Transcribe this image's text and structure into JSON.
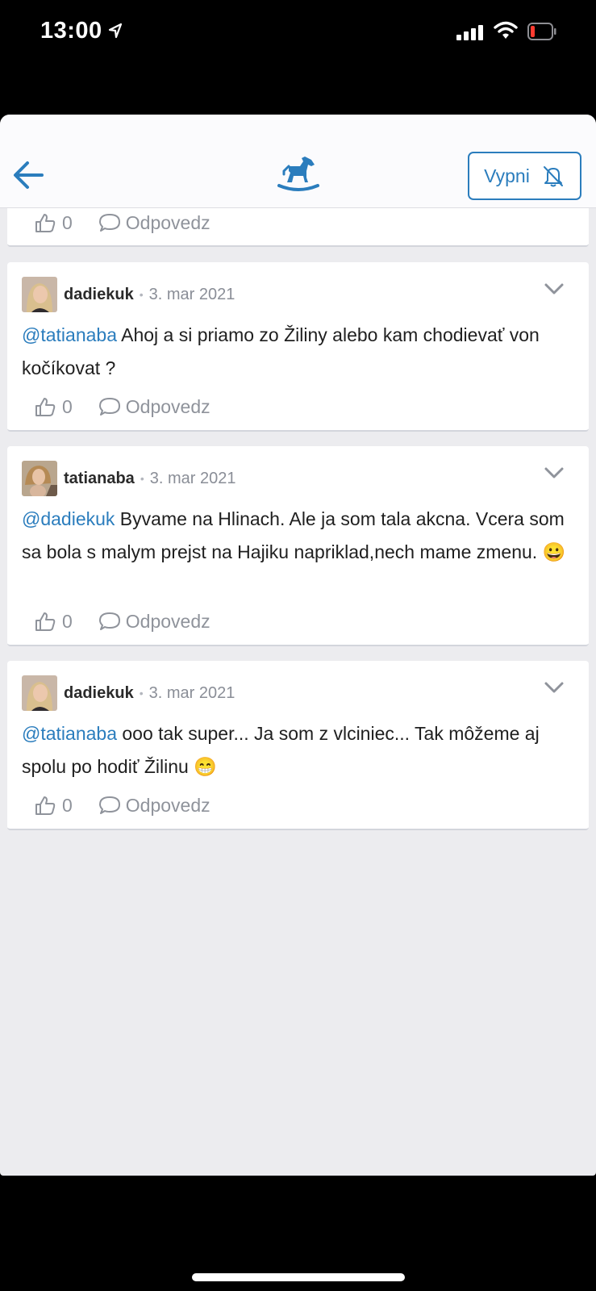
{
  "status_bar": {
    "time": "13:00"
  },
  "header": {
    "back_icon": "arrow-left-icon",
    "logo_icon": "rocking-horse-icon",
    "unsubscribe_label": "Vypni",
    "bell_icon": "bell-off-icon"
  },
  "partial_card": {
    "likes": "0",
    "reply_label": "Odpovedz"
  },
  "comments": [
    {
      "username": "dadiekuk",
      "separator": "•",
      "date": "3. mar 2021",
      "mention": "@tatianaba",
      "text": " Ahoj a si priamo zo Žiliny alebo kam chodievať von kočíkovat ?",
      "likes": "0",
      "reply_label": "Odpovedz"
    },
    {
      "username": "tatianaba",
      "separator": "•",
      "date": "3. mar 2021",
      "mention": "@dadiekuk",
      "text": " Byvame na Hlinach. Ale ja som tala akcna. Vcera som sa bola s malym prejst na Hajiku napriklad,nech mame zmenu. 😀",
      "likes": "0",
      "reply_label": "Odpovedz"
    },
    {
      "username": "dadiekuk",
      "separator": "•",
      "date": "3. mar 2021",
      "mention": "@tatianaba",
      "text": " ooo tak super... Ja som z vlciniec... Tak môžeme aj spolu po hodiť Žilinu 😁",
      "likes": "0",
      "reply_label": "Odpovedz"
    }
  ],
  "colors": {
    "accent": "#2b7dbd",
    "background": "#ececef",
    "card": "#ffffff",
    "muted": "#8f939b"
  }
}
